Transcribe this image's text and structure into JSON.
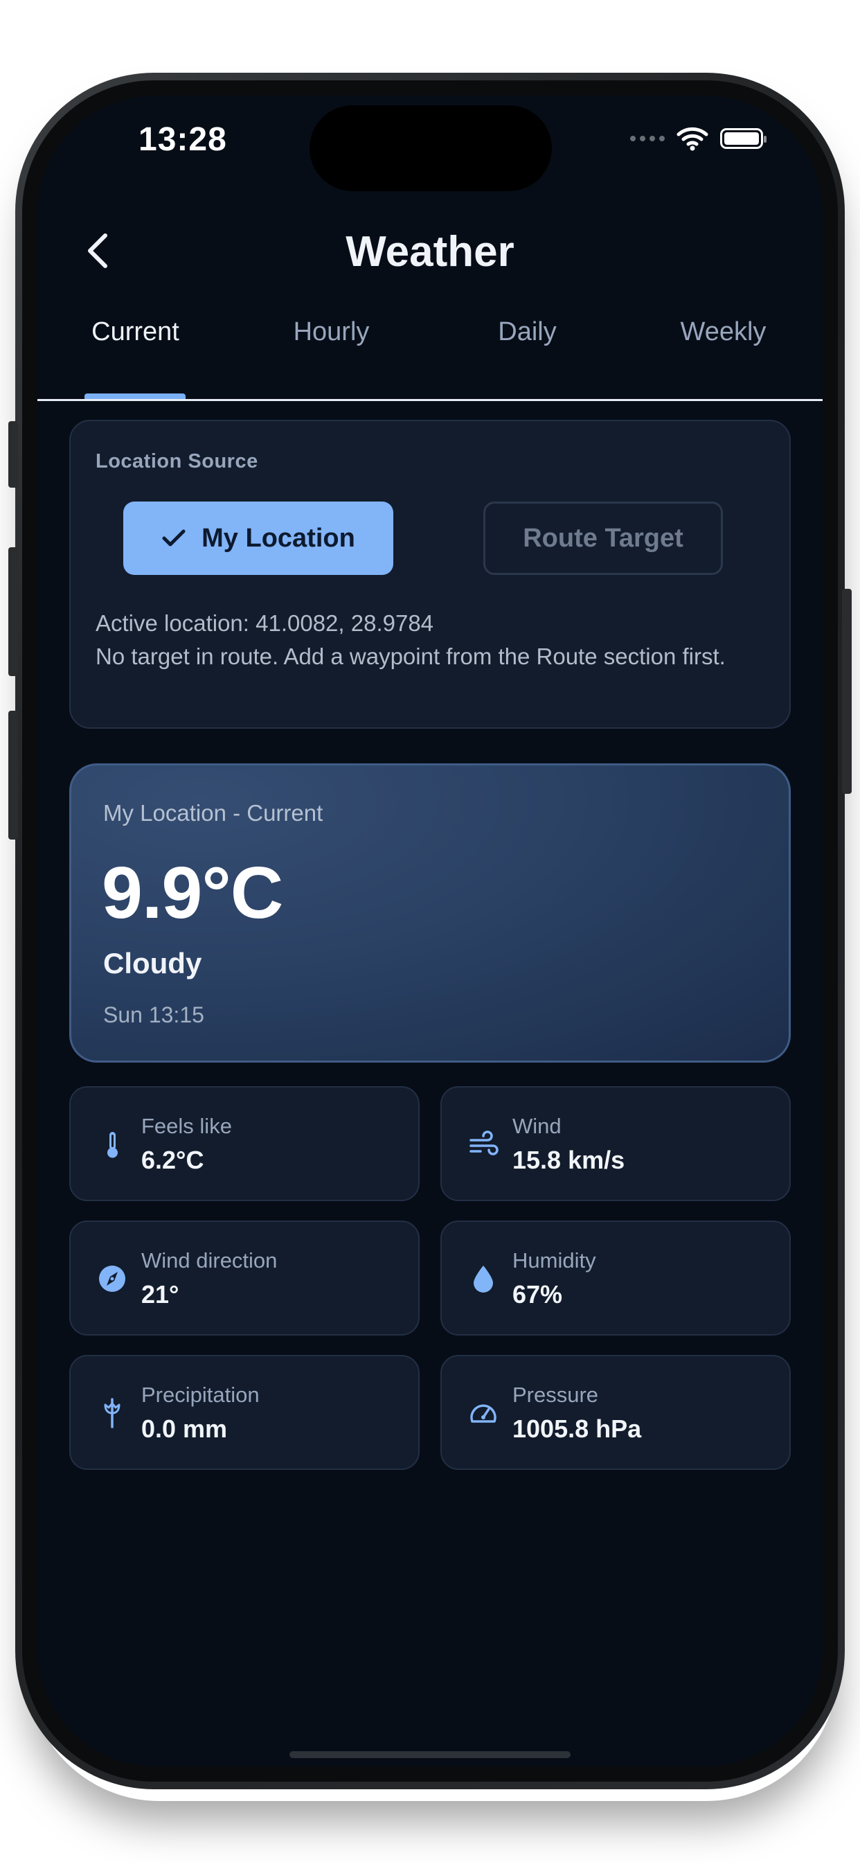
{
  "status_bar": {
    "time": "13:28"
  },
  "header": {
    "title": "Weather"
  },
  "tabs": [
    {
      "label": "Current",
      "active": true
    },
    {
      "label": "Hourly",
      "active": false
    },
    {
      "label": "Daily",
      "active": false
    },
    {
      "label": "Weekly",
      "active": false
    }
  ],
  "location_source": {
    "label": "Location Source",
    "my_location_label": "My Location",
    "route_target_label": "Route Target",
    "active_location": "Active location: 41.0082, 28.9784",
    "route_hint": "No target in route. Add a waypoint from the Route section first."
  },
  "current": {
    "subtitle": "My Location - Current",
    "temperature": "9.9°C",
    "condition": "Cloudy",
    "timestamp": "Sun 13:15"
  },
  "metrics": [
    {
      "label": "Feels like",
      "value": "6.2°C",
      "icon": "thermometer-icon"
    },
    {
      "label": "Wind",
      "value": "15.8 km/s",
      "icon": "wind-icon"
    },
    {
      "label": "Wind direction",
      "value": "21°",
      "icon": "compass-icon"
    },
    {
      "label": "Humidity",
      "value": "67%",
      "icon": "droplet-icon"
    },
    {
      "label": "Precipitation",
      "value": "0.0 mm",
      "icon": "umbrella-icon"
    },
    {
      "label": "Pressure",
      "value": "1005.8 hPa",
      "icon": "gauge-icon"
    }
  ],
  "colors": {
    "background": "#070d17",
    "card": "#121c2c",
    "accent": "#82b4f8",
    "hero": "#2a4164"
  }
}
